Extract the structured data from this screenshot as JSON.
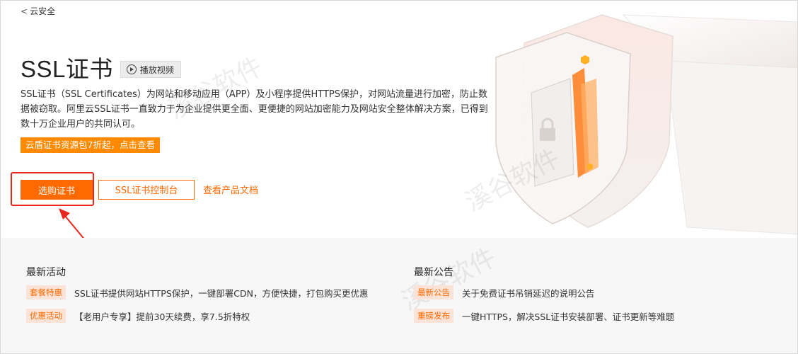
{
  "nav": {
    "back_label": "云安全"
  },
  "hero": {
    "title": "SSL证书",
    "play_video_label": "播放视频",
    "description": "SSL证书（SSL Certificates）为网站和移动应用（APP）及小程序提供HTTPS保护，对网站流量进行加密，防止数据被窃取。阿里云SSL证书一直致力于为企业提供更全面、更便捷的网站加密能力及网站安全整体解决方案，已得到数十万企业用户的共同认可。",
    "promo_label": "云盾证书资源包7折起，点击查看",
    "buy_button": "选购证书",
    "console_button": "SSL证书控制台",
    "docs_link": "查看产品文档"
  },
  "activities": {
    "title": "最新活动",
    "items": [
      {
        "tag": "套餐特惠",
        "text": "SSL证书提供网站HTTPS保护，一键部署CDN，方便快捷，打包购买更优惠"
      },
      {
        "tag": "优惠活动",
        "text": "【老用户专享】提前30天续费，享7.5折特权"
      }
    ]
  },
  "announcements": {
    "title": "最新公告",
    "items": [
      {
        "tag": "最新公告",
        "text": "关于免费证书吊销延迟的说明公告"
      },
      {
        "tag": "重磅发布",
        "text": "一键HTTPS，解决SSL证书安装部署、证书更新等难题"
      }
    ]
  },
  "watermark": "溪谷软件",
  "colors": {
    "accent": "#ff6a00",
    "highlight_border": "#e8281e",
    "promo": "#ff8a00"
  },
  "icons": [
    "play-icon",
    "back-chevron-icon",
    "shield-illustration",
    "annotation-arrow"
  ]
}
